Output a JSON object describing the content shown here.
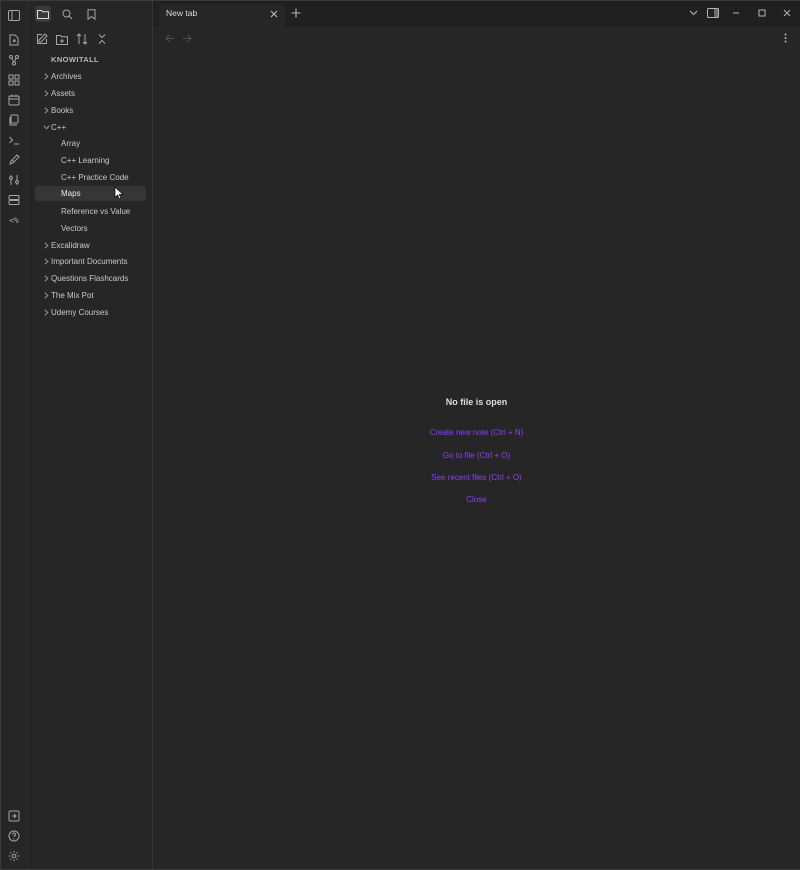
{
  "vault": {
    "name": "KNOWITALL"
  },
  "tree": [
    {
      "label": "Archives",
      "expanded": false
    },
    {
      "label": "Assets",
      "expanded": false
    },
    {
      "label": "Books",
      "expanded": false
    },
    {
      "label": "C++",
      "expanded": true
    },
    {
      "label": "Array",
      "child": true
    },
    {
      "label": "C++ Learning",
      "child": true
    },
    {
      "label": "C++ Practice Code",
      "child": true
    },
    {
      "label": "Maps",
      "child": true,
      "selected": true
    },
    {
      "label": "Reference vs Value",
      "child": true
    },
    {
      "label": "Vectors",
      "child": true
    },
    {
      "label": "Excalidraw",
      "expanded": false
    },
    {
      "label": "Important Documents",
      "expanded": false
    },
    {
      "label": "Questions Flashcards",
      "expanded": false
    },
    {
      "label": "The Mix Pot",
      "expanded": false
    },
    {
      "label": "Udemy Courses",
      "expanded": false
    }
  ],
  "tabs": [
    {
      "title": "New tab",
      "active": true
    }
  ],
  "empty_state": {
    "title": "No file is open",
    "actions": [
      "Create new note (Ctrl + N)",
      "Go to file (Ctrl + O)",
      "See recent files (Ctrl + O)",
      "Close"
    ]
  },
  "colors": {
    "accent": "#8a3ffc",
    "background": "#262626",
    "tabbar": "#202020"
  }
}
